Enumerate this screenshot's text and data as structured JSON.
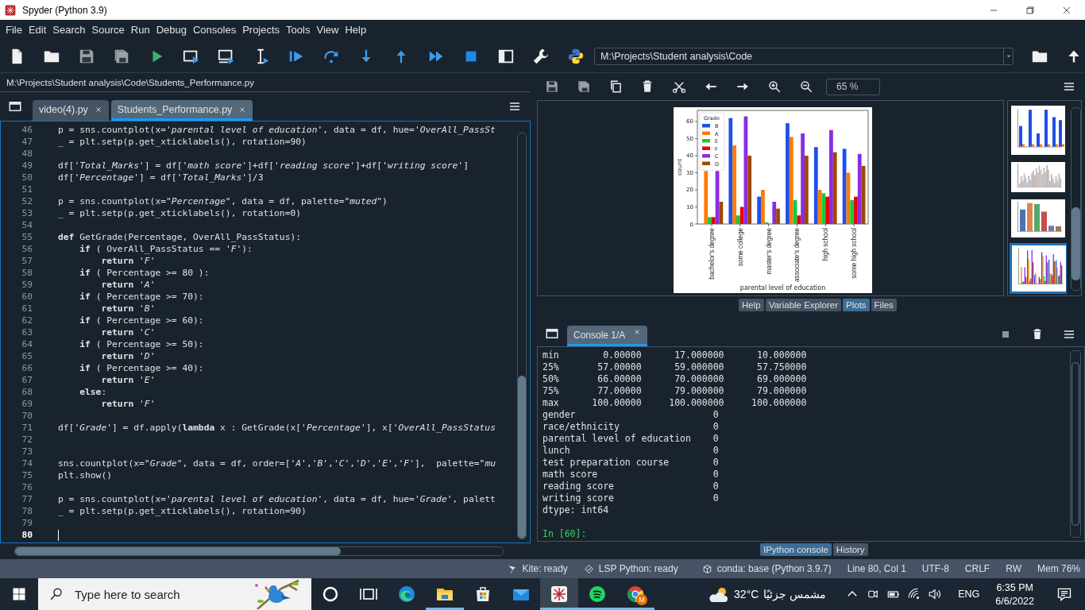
{
  "window": {
    "title": "Spyder (Python 3.9)"
  },
  "menu": [
    "File",
    "Edit",
    "Search",
    "Source",
    "Run",
    "Debug",
    "Consoles",
    "Projects",
    "Tools",
    "View",
    "Help"
  ],
  "toolbar": {
    "working_directory": "M:\\Projects\\Student analysis\\Code"
  },
  "editor": {
    "file_path": "M:\\Projects\\Student analysis\\Code\\Students_Performance.py",
    "tabs": [
      {
        "label": "video(4).py",
        "selected": false
      },
      {
        "label": "Students_Performance.py",
        "selected": true
      }
    ],
    "lines": [
      {
        "n": "46",
        "current": false,
        "code": "p = sns.countplot(x=*'parental level of education'*, data = df, hue=*'OverAll_PassSt*"
      },
      {
        "n": "47",
        "current": false,
        "code": "_ = plt.setp(p.get_xticklabels(), rotation=90)"
      },
      {
        "n": "48",
        "current": false
      },
      {
        "n": "49",
        "current": false,
        "code": "df[*'Total_Marks'*] = df[*'math score'*]+df[*'reading score'*]+df[*'writing score'*]"
      },
      {
        "n": "50",
        "current": false,
        "code": "df[*'Percentage'*] = df[*'Total_Marks'*]/3"
      },
      {
        "n": "51",
        "current": false
      },
      {
        "n": "52",
        "current": false,
        "code": "p = sns.countplot(x=*\"Percentage\"*, data = df, palette=*\"muted\"*)"
      },
      {
        "n": "53",
        "current": false,
        "code": "_ = plt.setp(p.get_xticklabels(), rotation=0)"
      },
      {
        "n": "54",
        "current": false
      },
      {
        "n": "55",
        "current": false,
        "code": "**def** GetGrade(Percentage, OverAll_PassStatus):"
      },
      {
        "n": "56",
        "current": false,
        "code": "    **if** ( OverAll_PassStatus == *'F'*):"
      },
      {
        "n": "57",
        "current": false,
        "code": "        **return** *'F'*"
      },
      {
        "n": "58",
        "current": false,
        "code": "    **if** ( Percentage >= 80 ):"
      },
      {
        "n": "59",
        "current": false,
        "code": "        **return** *'A'*"
      },
      {
        "n": "60",
        "current": false,
        "code": "    **if** ( Percentage >= 70):"
      },
      {
        "n": "61",
        "current": false,
        "code": "        **return** *'B'*"
      },
      {
        "n": "62",
        "current": false,
        "code": "    **if** ( Percentage >= 60):"
      },
      {
        "n": "63",
        "current": false,
        "code": "        **return** *'C'*"
      },
      {
        "n": "64",
        "current": false,
        "code": "    **if** ( Percentage >= 50):"
      },
      {
        "n": "65",
        "current": false,
        "code": "        **return** *'D'*"
      },
      {
        "n": "66",
        "current": false,
        "code": "    **if** ( Percentage >= 40):"
      },
      {
        "n": "67",
        "current": false,
        "code": "        **return** *'E'*"
      },
      {
        "n": "68",
        "current": false,
        "code": "    **else**:"
      },
      {
        "n": "69",
        "current": false,
        "code": "        **return** *'F'*"
      },
      {
        "n": "70",
        "current": false
      },
      {
        "n": "71",
        "current": false,
        "code": "df[*'Grade'*] = df.apply(**lambda** x : GetGrade(x[*'Percentage'*], x[*'OverAll_PassStatus*"
      },
      {
        "n": "72",
        "current": false
      },
      {
        "n": "73",
        "current": false
      },
      {
        "n": "74",
        "current": false,
        "code": "sns.countplot(x=*\"Grade\"*, data = df, order=[*'A'*,*'B'*,*'C'*,*'D'*,*'E'*,*'F'*],  palette=*\"mu*"
      },
      {
        "n": "75",
        "current": false,
        "code": "plt.show()"
      },
      {
        "n": "76",
        "current": false
      },
      {
        "n": "77",
        "current": false,
        "code": "p = sns.countplot(x=*'parental level of education'*, data = df, hue=*'Grade'*, palett"
      },
      {
        "n": "78",
        "current": false,
        "code": "_ = plt.setp(p.get_xticklabels(), rotation=90)"
      },
      {
        "n": "79",
        "current": false
      },
      {
        "n": "80",
        "current": true
      }
    ]
  },
  "plots": {
    "zoom": "65 %",
    "chart_data": {
      "type": "bar",
      "xlabel": "parental level of education",
      "ylabel": "count",
      "legend": {
        "title": "Grade"
      },
      "categories": [
        "bachelor's degree",
        "some college",
        "master's degree",
        "associate's degree",
        "high school",
        "some high school"
      ],
      "series": [
        {
          "name": "B",
          "color": "#1f4fe8",
          "values": [
            null,
            62,
            16,
            59,
            45,
            44
          ]
        },
        {
          "name": "A",
          "color": "#ff7c00",
          "values": [
            31,
            46,
            20,
            51,
            20,
            30
          ]
        },
        {
          "name": "E",
          "color": "#1ac938",
          "values": [
            4,
            5,
            1,
            14,
            18,
            14
          ]
        },
        {
          "name": "F",
          "color": "#e8000b",
          "values": [
            4,
            10,
            0,
            5,
            16,
            16
          ]
        },
        {
          "name": "C",
          "color": "#8b2be2",
          "values": [
            31,
            63,
            13,
            53,
            55,
            41
          ]
        },
        {
          "name": "D",
          "color": "#9f4800",
          "values": [
            13,
            40,
            9,
            40,
            42,
            34
          ]
        }
      ],
      "ylim": [
        0,
        66.5
      ],
      "yticks": [
        0,
        10,
        20,
        30,
        40,
        50,
        60
      ]
    },
    "thumbnails": [
      {
        "kind": "bar",
        "selected": false
      },
      {
        "kind": "histogram",
        "selected": false
      },
      {
        "kind": "patterned-bar",
        "selected": false
      },
      {
        "kind": "grouped-bar",
        "selected": true
      }
    ],
    "pane_tabs": [
      {
        "label": "Help",
        "selected": false
      },
      {
        "label": "Variable Explorer",
        "selected": false
      },
      {
        "label": "Plots",
        "selected": true
      },
      {
        "label": "Files",
        "selected": false
      }
    ]
  },
  "console": {
    "tabs": [
      {
        "label": "Console 1/A",
        "selected": true
      }
    ],
    "lines": [
      "min        0.00000      17.000000      10.000000",
      "25%       57.00000      59.000000      57.750000",
      "50%       66.00000      70.000000      69.000000",
      "75%       77.00000      79.000000      79.000000",
      "max      100.00000     100.000000     100.000000",
      "gender                         0",
      "race/ethnicity                 0",
      "parental level of education    0",
      "lunch                          0",
      "test preparation course        0",
      "math score                     0",
      "reading score                  0",
      "writing score                  0",
      "dtype: int64"
    ],
    "prompt": "In [60]:",
    "bottom_tabs": [
      {
        "label": "IPython console",
        "selected": true
      },
      {
        "label": "History",
        "selected": false
      }
    ]
  },
  "status_bar": [
    "Kite: ready",
    "LSP Python: ready",
    "conda: base (Python 3.9.7)",
    "Line 80, Col 1",
    "UTF-8",
    "CRLF",
    "RW",
    "Mem 76%"
  ],
  "taskbar": {
    "search_placeholder": "Type here to search",
    "apps": [
      {
        "kind": "cortana",
        "open": false,
        "active": false
      },
      {
        "kind": "task-view",
        "open": false,
        "active": false
      },
      {
        "kind": "edge",
        "open": false,
        "active": false
      },
      {
        "kind": "explorer",
        "open": true,
        "active": false
      },
      {
        "kind": "store",
        "open": false,
        "active": false
      },
      {
        "kind": "mail",
        "open": false,
        "active": false
      },
      {
        "kind": "spyder",
        "open": true,
        "active": true
      },
      {
        "kind": "spotify",
        "open": true,
        "active": false
      },
      {
        "kind": "chrome",
        "open": true,
        "active": false,
        "badge": "M"
      }
    ],
    "weather": {
      "temperature": "32°C",
      "condition": "مشمس جزئيًا"
    },
    "language": "ENG",
    "time": "6:35 PM",
    "date": "6/6/2022"
  }
}
